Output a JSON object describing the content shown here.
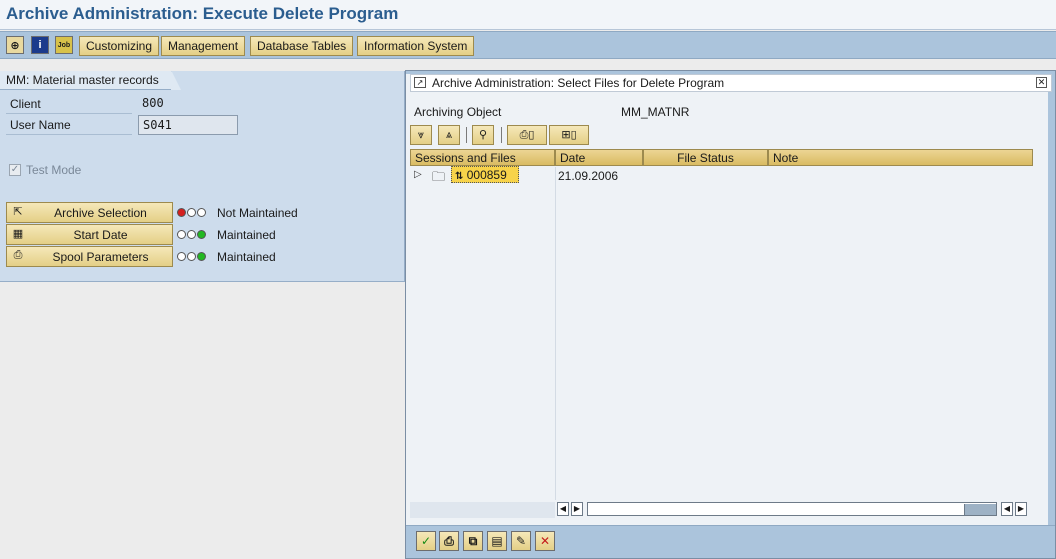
{
  "header": {
    "title": "Archive Administration: Execute Delete Program"
  },
  "toolbar": {
    "icons": [
      {
        "name": "execute-icon",
        "glyph": "⊕"
      },
      {
        "name": "info-icon",
        "glyph": "i"
      },
      {
        "name": "job-icon",
        "glyph": "Job"
      }
    ],
    "buttons": [
      "Customizing",
      "Management",
      "Database Tables",
      "Information System"
    ]
  },
  "left_panel": {
    "tab_label": "MM: Material master records",
    "client_label": "Client",
    "client_value": "800",
    "user_label": "User Name",
    "user_value": "S041",
    "test_mode_label": "Test Mode",
    "test_mode_checked": true,
    "params": [
      {
        "button": "Archive Selection",
        "status": "Not Maintained",
        "light": "red"
      },
      {
        "button": "Start Date",
        "status": "Maintained",
        "light": "green"
      },
      {
        "button": "Spool Parameters",
        "status": "Maintained",
        "light": "green"
      }
    ]
  },
  "dialog": {
    "title": "Archive Administration: Select Files for Delete Program",
    "archiving_object_label": "Archiving Object",
    "archiving_object_value": "MM_MATNR",
    "columns": [
      "Sessions and Files",
      "Date",
      "File Status",
      "Note"
    ],
    "rows": [
      {
        "session": "000859",
        "date": "21.09.2006",
        "file_status": "",
        "note": ""
      }
    ]
  },
  "colors": {
    "title_text": "#2b5d8f",
    "toolbar_bg": "#abc4dc",
    "button_gold": "#e4cf86",
    "selected_node": "#f7d34a",
    "light_red": "#d42020",
    "light_green": "#22b822"
  }
}
